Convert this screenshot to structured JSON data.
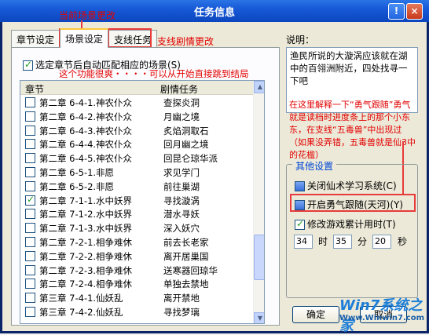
{
  "window": {
    "title": "任务信息",
    "help_label": "!",
    "close_label": "×"
  },
  "tabs": [
    {
      "label": "章节设定"
    },
    {
      "label": "场景设定"
    },
    {
      "label": "支线任务"
    }
  ],
  "annotations": {
    "scene_change": "当前场景更改",
    "side_change": "支线剧情更改",
    "feature_tip": "这个功能很爽・・・・可以从开始直接跳到结局",
    "note": "在这里解释一下“勇气跟随”勇气就是读档时进度条上的那个小东东，在支线“五毒兽”中出现过（如果没弄错，五毒兽就是仙3中的花楹）"
  },
  "auto_match": {
    "label": "选定章节后自动匹配相应的场景(S)",
    "checked": true
  },
  "list": {
    "headers": [
      "章节",
      "剧情任务"
    ],
    "rows": [
      {
        "chapter": "第二章 6-4-1.神农仆众",
        "task": "查探炎洞",
        "checked": false
      },
      {
        "chapter": "第二章 6-4-2.神农仆众",
        "task": "月幽之境",
        "checked": false
      },
      {
        "chapter": "第二章 6-4-3.神农仆众",
        "task": "炙焰洞取石",
        "checked": false
      },
      {
        "chapter": "第二章 6-4-4.神农仆众",
        "task": "回月幽之境",
        "checked": false
      },
      {
        "chapter": "第二章 6-4-5.神农仆众",
        "task": "回昆仑琼华派",
        "checked": false
      },
      {
        "chapter": "第二章 6-5-1.非愿",
        "task": "求见学门",
        "checked": false
      },
      {
        "chapter": "第二章 6-5-2.非愿",
        "task": "前往巢湖",
        "checked": false
      },
      {
        "chapter": "第二章 7-1-1.水中妖界",
        "task": "寻找漩涡",
        "checked": true
      },
      {
        "chapter": "第二章 7-1-2.水中妖界",
        "task": "潜水寻妖",
        "checked": false
      },
      {
        "chapter": "第二章 7-1-3.水中妖界",
        "task": "深入妖穴",
        "checked": false
      },
      {
        "chapter": "第二章 7-2-1.相争难休",
        "task": "前去长老家",
        "checked": false
      },
      {
        "chapter": "第二章 7-2-2.相争难休",
        "task": "离开居巢国",
        "checked": false
      },
      {
        "chapter": "第二章 7-2-3.相争难休",
        "task": "送寒器回琼华",
        "checked": false
      },
      {
        "chapter": "第二章 7-2-4.相争难休",
        "task": "单独去禁地",
        "checked": false
      },
      {
        "chapter": "第三章 7-4-1.仙妖乱",
        "task": "离开禁地",
        "checked": false
      },
      {
        "chapter": "第三章 7-4-2.仙妖乱",
        "task": "寻找梦璃",
        "checked": false
      }
    ]
  },
  "description": {
    "label": "说明：",
    "text": "渔民所说的大漩涡应该就在湖中的百翎洲附近，四处找寻一下吧"
  },
  "settings": {
    "title": "其他设置",
    "close_learn": "关闭仙术学习系统(C)",
    "courage": "开启勇气跟随(天河)(Y)",
    "modify_time": "修改游戏累计用时(T)",
    "hours": "34",
    "hour_label": "时",
    "minutes": "35",
    "minute_label": "分",
    "seconds": "20",
    "second_label": "秒"
  },
  "buttons": {
    "ok": "确定",
    "cancel": "取消"
  },
  "watermark": {
    "logo": "Win7系统之家",
    "url": "Www.Winwin7.com"
  }
}
